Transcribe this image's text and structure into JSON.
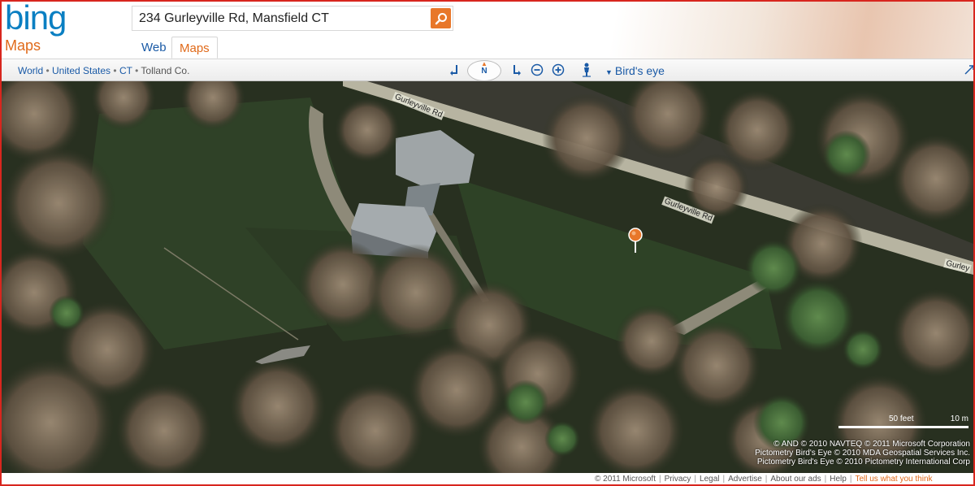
{
  "header": {
    "logo_text": "bing",
    "product_name": "Maps",
    "search": {
      "value": "234 Gurleyville Rd, Mansfield CT",
      "button_icon": "search-icon"
    },
    "tabs": [
      {
        "label": "Web",
        "active": false
      },
      {
        "label": "Maps",
        "active": true
      }
    ]
  },
  "toolbar": {
    "breadcrumb": [
      "World",
      "United States",
      "CT",
      "Tolland Co."
    ],
    "breadcrumb_separator": "•",
    "compass_label": "N",
    "view_mode": "Bird's eye",
    "icons": [
      "rotate-left-icon",
      "compass-icon",
      "rotate-right-icon",
      "zoom-out-icon",
      "zoom-in-icon",
      "person-icon",
      "dropdown-caret-icon",
      "expand-icon"
    ]
  },
  "map": {
    "road_labels": [
      "Gurleyville Rd",
      "Gurleyville Rd",
      "Gurley"
    ],
    "pin_color": "#e8772a",
    "scale": {
      "imperial": "50 feet",
      "metric": "10 m"
    },
    "credits": [
      "© AND  © 2010 NAVTEQ  © 2011 Microsoft Corporation",
      "Pictometry Bird's Eye © 2010 MDA Geospatial Services Inc.",
      "Pictometry Bird's Eye © 2010 Pictometry International Corp"
    ]
  },
  "footer": {
    "copyright": "© 2011 Microsoft",
    "links": [
      "Privacy",
      "Legal",
      "Advertise",
      "About our ads",
      "Help"
    ],
    "feedback": "Tell us what you think"
  },
  "colors": {
    "accent": "#e06a1a",
    "link": "#1a5aa6",
    "border": "#d8261e",
    "logo": "#0a7fc2"
  }
}
